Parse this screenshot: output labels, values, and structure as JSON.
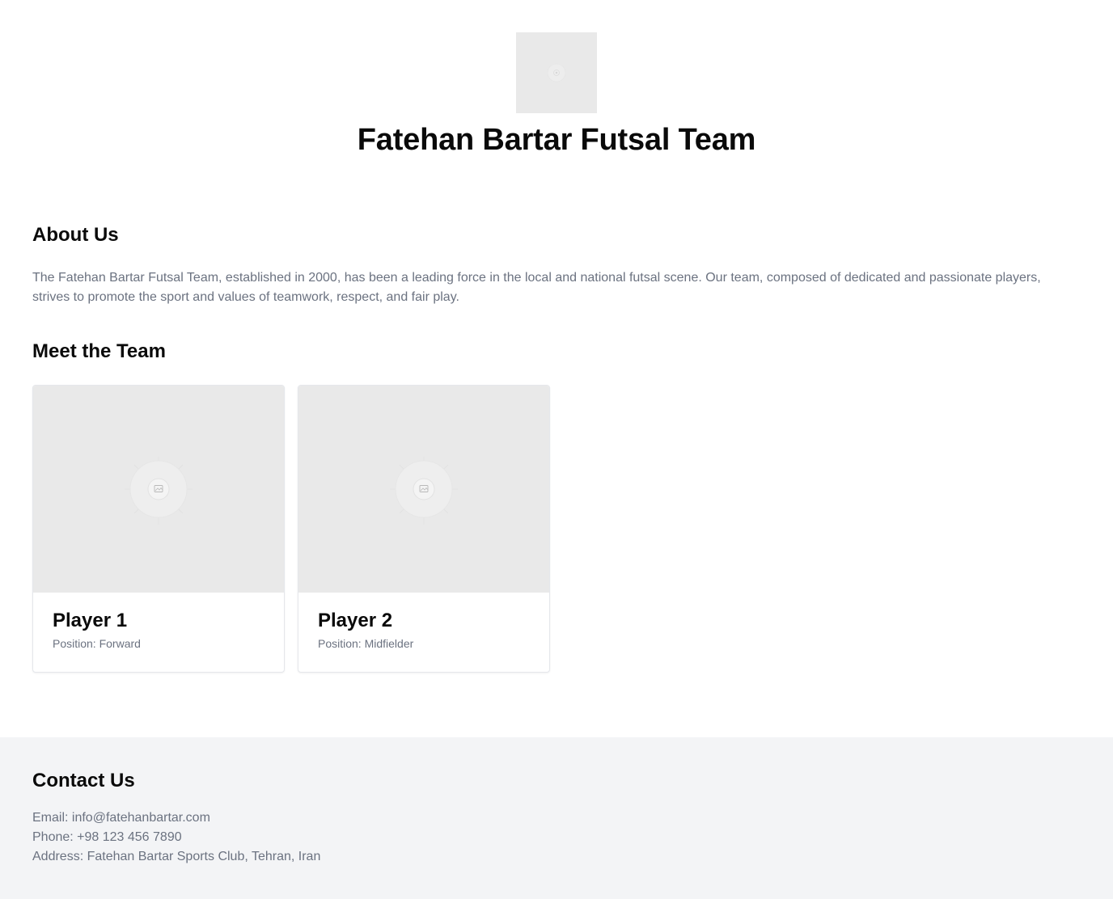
{
  "header": {
    "logo_icon": "image-placeholder-icon",
    "title": "Fatehan Bartar Futsal Team"
  },
  "about": {
    "heading": "About Us",
    "text": "The Fatehan Bartar Futsal Team, established in 2000, has been a leading force in the local and national futsal scene. Our team, composed of dedicated and passionate players, strives to promote the sport and values of teamwork, respect, and fair play."
  },
  "team": {
    "heading": "Meet the Team",
    "players": [
      {
        "name": "Player 1",
        "position": "Position: Forward",
        "photo_icon": "image-placeholder-icon"
      },
      {
        "name": "Player 2",
        "position": "Position: Midfielder",
        "photo_icon": "image-placeholder-icon"
      }
    ]
  },
  "contact": {
    "heading": "Contact Us",
    "email": "Email: info@fatehanbartar.com",
    "phone": "Phone: +98 123 456 7890",
    "address": "Address: Fatehan Bartar Sports Club, Tehran, Iran"
  },
  "colors": {
    "placeholder_bg": "#e9e9e9",
    "muted_text": "#6b7280",
    "footer_bg": "#f3f4f6"
  }
}
